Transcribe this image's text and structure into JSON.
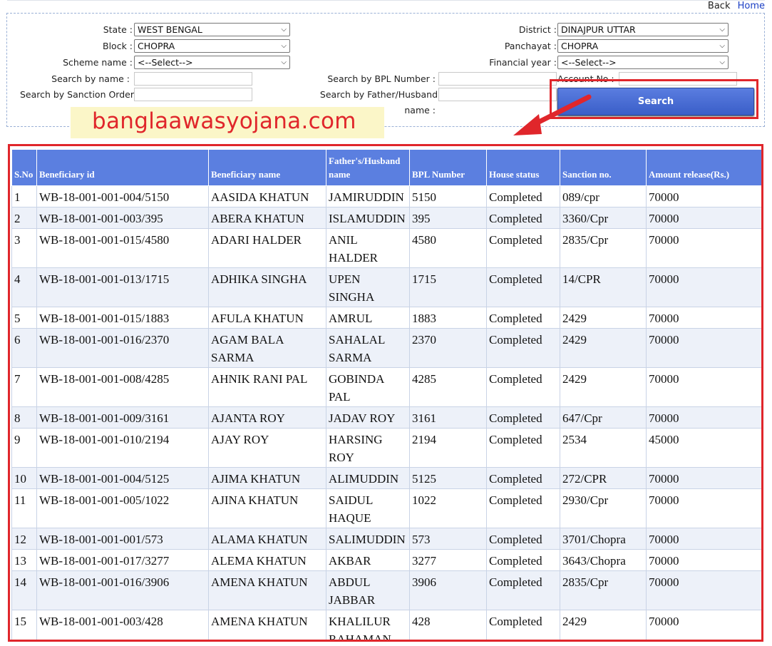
{
  "nav": {
    "back": "Back",
    "home": "Home"
  },
  "filters": {
    "state_label": "State :",
    "state_value": "WEST BENGAL",
    "district_label": "District :",
    "district_value": "DINAJPUR UTTAR",
    "block_label": "Block :",
    "block_value": "CHOPRA",
    "panchayat_label": "Panchayat :",
    "panchayat_value": "CHOPRA",
    "scheme_label": "Scheme name :",
    "scheme_value": "<--Select-->",
    "fy_label": "Financial year :",
    "fy_value": "<--Select-->",
    "search_name_label": "Search by name :",
    "search_bpl_label": "Search by BPL Number :",
    "account_label": "Account No :",
    "search_sanction_label": "Search by Sanction Order",
    "search_father_label_1": "Search by Father/Husband",
    "search_father_label_2": "name :",
    "search_button": "Search"
  },
  "watermark": "banglaawasyojana.com",
  "table": {
    "headers": [
      "S.No",
      "Beneficiary id",
      "Beneficiary name",
      "Father's/Husband name",
      "BPL Number",
      "House status",
      "Sanction no.",
      "Amount release(Rs.)"
    ],
    "rows": [
      [
        "1",
        "WB-18-001-001-004/5150",
        "AASIDA KHATUN",
        "JAMIRUDDIN",
        "5150",
        "Completed",
        "089/cpr",
        "70000"
      ],
      [
        "2",
        "WB-18-001-001-003/395",
        "ABERA KHATUN",
        "ISLAMUDDIN",
        "395",
        "Completed",
        "3360/Cpr",
        "70000"
      ],
      [
        "3",
        "WB-18-001-001-015/4580",
        "ADARI HALDER",
        "ANIL HALDER",
        "4580",
        "Completed",
        "2835/Cpr",
        "70000"
      ],
      [
        "4",
        "WB-18-001-001-013/1715",
        "ADHIKA SINGHA",
        "UPEN SINGHA",
        "1715",
        "Completed",
        "14/CPR",
        "70000"
      ],
      [
        "5",
        "WB-18-001-001-015/1883",
        "AFULA KHATUN",
        "AMRUL",
        "1883",
        "Completed",
        "2429",
        "70000"
      ],
      [
        "6",
        "WB-18-001-001-016/2370",
        "AGAM BALA SARMA",
        "SAHALAL SARMA",
        "2370",
        "Completed",
        "2429",
        "70000"
      ],
      [
        "7",
        "WB-18-001-001-008/4285",
        "AHNIK RANI PAL",
        "GOBINDA PAL",
        "4285",
        "Completed",
        "2429",
        "70000"
      ],
      [
        "8",
        "WB-18-001-001-009/3161",
        "AJANTA ROY",
        "JADAV ROY",
        "3161",
        "Completed",
        "647/Cpr",
        "70000"
      ],
      [
        "9",
        "WB-18-001-001-010/2194",
        "AJAY ROY",
        "HARSING ROY",
        "2194",
        "Completed",
        "2534",
        "45000"
      ],
      [
        "10",
        "WB-18-001-001-004/5125",
        "AJIMA KHATUN",
        "ALIMUDDIN",
        "5125",
        "Completed",
        "272/CPR",
        "70000"
      ],
      [
        "11",
        "WB-18-001-001-005/1022",
        "AJINA KHATUN",
        "SAIDUL HAQUE",
        "1022",
        "Completed",
        "2930/Cpr",
        "70000"
      ],
      [
        "12",
        "WB-18-001-001-001/573",
        "ALAMA KHATUN",
        "SALIMUDDIN",
        "573",
        "Completed",
        "3701/Chopra",
        "70000"
      ],
      [
        "13",
        "WB-18-001-001-017/3277",
        "ALEMA KHATUN",
        "AKBAR",
        "3277",
        "Completed",
        "3643/Chopra",
        "70000"
      ],
      [
        "14",
        "WB-18-001-001-016/3906",
        "AMENA KHATUN",
        "ABDUL JABBAR",
        "3906",
        "Completed",
        "2835/Cpr",
        "70000"
      ],
      [
        "15",
        "WB-18-001-001-003/428",
        "AMENA KHATUN",
        "KHALILUR RAHAMAN",
        "428",
        "Completed",
        "2429",
        "70000"
      ]
    ]
  },
  "colors": {
    "highlight": "#e0262b",
    "header_bg": "#5b7fe0",
    "button": "#3a5ec8"
  }
}
